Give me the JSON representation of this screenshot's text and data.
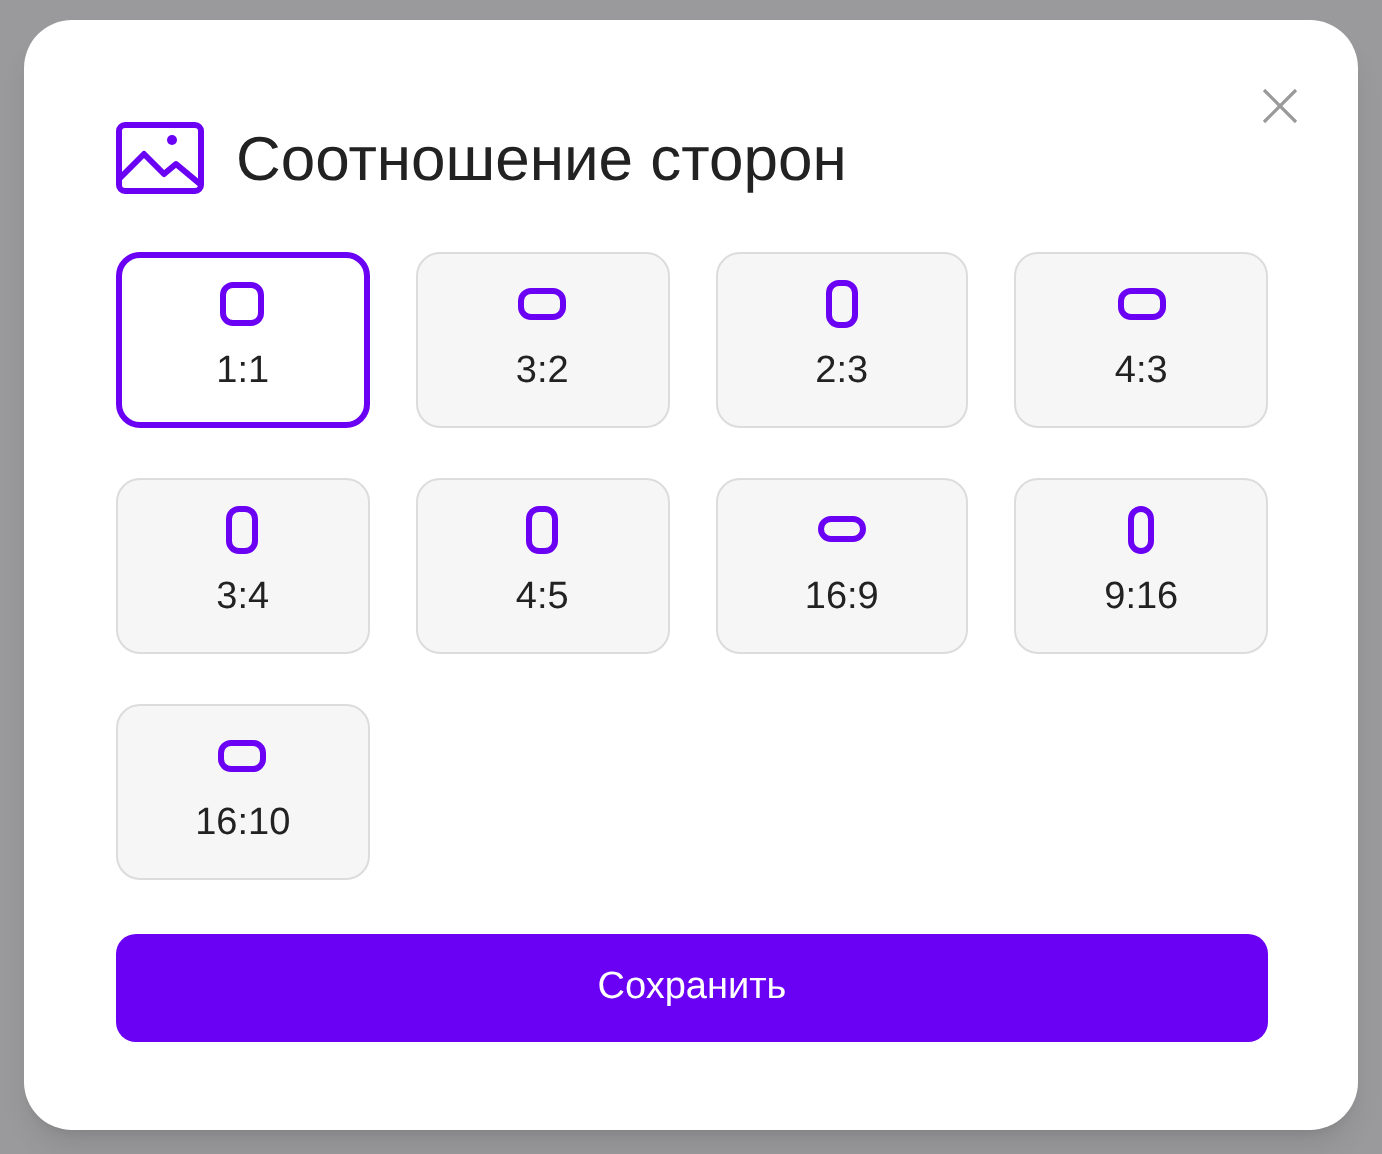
{
  "dialog": {
    "title": "Соотношение сторон",
    "options": [
      {
        "label": "1:1",
        "kind": "square",
        "selected": true
      },
      {
        "label": "3:2",
        "kind": "landscape",
        "selected": false
      },
      {
        "label": "2:3",
        "kind": "portrait",
        "selected": false
      },
      {
        "label": "4:3",
        "kind": "landscape",
        "selected": false
      },
      {
        "label": "3:4",
        "kind": "portrait",
        "selected": false
      },
      {
        "label": "4:5",
        "kind": "portrait",
        "selected": false
      },
      {
        "label": "16:9",
        "kind": "wide",
        "selected": false
      },
      {
        "label": "9:16",
        "kind": "tall",
        "selected": false
      },
      {
        "label": "16:10",
        "kind": "landscape",
        "selected": false
      }
    ],
    "save_button": "Сохранить"
  }
}
